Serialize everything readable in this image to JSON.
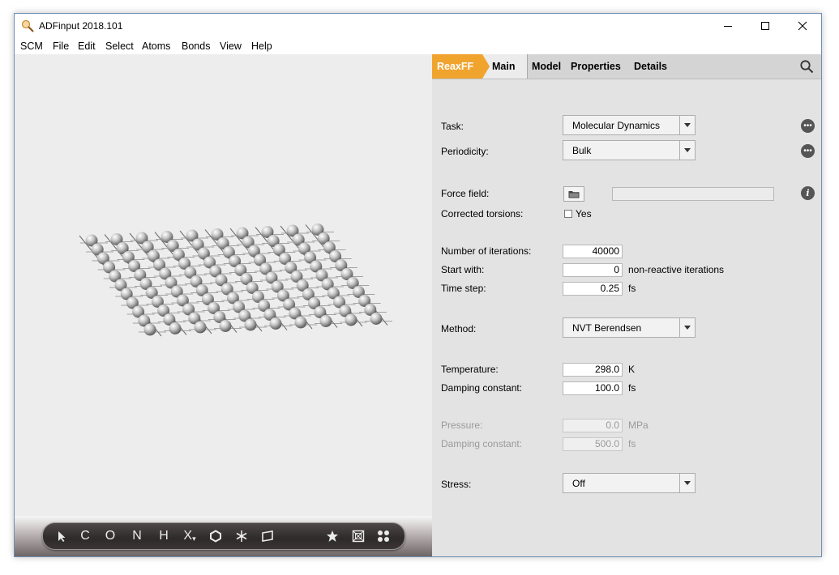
{
  "window": {
    "title": "ADFinput 2018.101"
  },
  "menu": [
    "SCM",
    "File",
    "Edit",
    "Select",
    "Atoms",
    "Bonds",
    "View",
    "Help"
  ],
  "tabs": {
    "engine": "ReaxFF",
    "active": "Main",
    "others": [
      "Model",
      "Properties",
      "Details"
    ]
  },
  "toolbar": {
    "items": [
      "select-arrow",
      "C",
      "O",
      "N",
      "H",
      "X",
      "ring",
      "snowflake",
      "plane",
      "star",
      "crop-box",
      "molecules"
    ]
  },
  "form": {
    "task": {
      "label": "Task:",
      "value": "Molecular Dynamics"
    },
    "periodicity": {
      "label": "Periodicity:",
      "value": "Bulk"
    },
    "force_field": {
      "label": "Force field:",
      "value": ""
    },
    "corrected_torsions": {
      "label": "Corrected torsions:",
      "option": "Yes",
      "checked": false
    },
    "iterations": {
      "label": "Number of iterations:",
      "value": "40000"
    },
    "start_with": {
      "label": "Start with:",
      "value": "0",
      "unit": "non-reactive iterations"
    },
    "time_step": {
      "label": "Time step:",
      "value": "0.25",
      "unit": "fs"
    },
    "method": {
      "label": "Method:",
      "value": "NVT Berendsen"
    },
    "temperature": {
      "label": "Temperature:",
      "value": "298.0",
      "unit": "K"
    },
    "damping": {
      "label": "Damping constant:",
      "value": "100.0",
      "unit": "fs"
    },
    "pressure": {
      "label": "Pressure:",
      "value": "0.0",
      "unit": "MPa",
      "enabled": false
    },
    "damping2": {
      "label": "Damping constant:",
      "value": "500.0",
      "unit": "fs",
      "enabled": false
    },
    "stress": {
      "label": "Stress:",
      "value": "Off"
    }
  }
}
